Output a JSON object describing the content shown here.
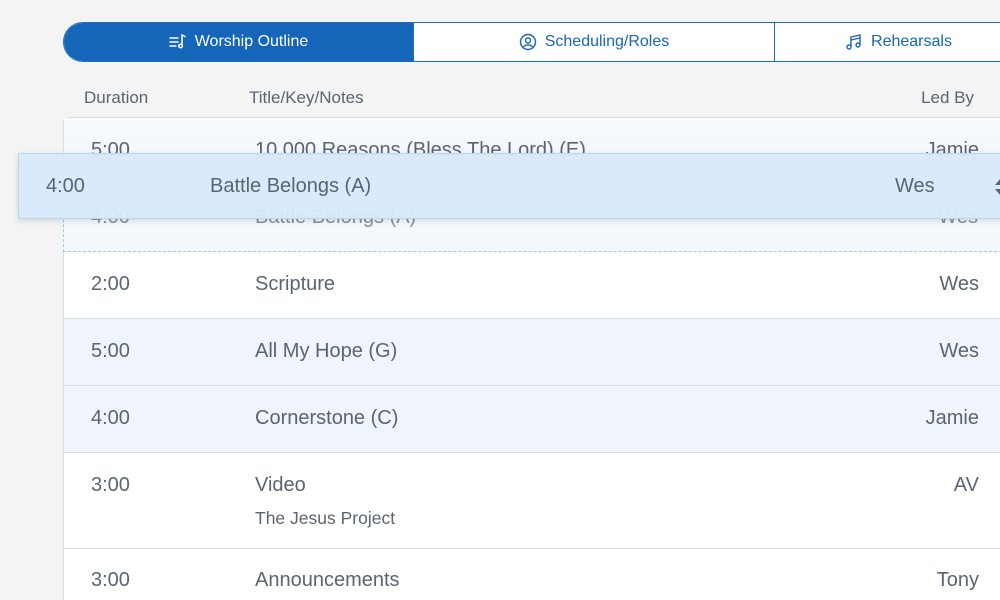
{
  "tabs": [
    {
      "label": "Worship Outline",
      "icon": "list-music-icon",
      "active": true
    },
    {
      "label": "Scheduling/Roles",
      "icon": "user-circle-icon",
      "active": false
    },
    {
      "label": "Rehearsals",
      "icon": "music-note-icon",
      "active": false
    }
  ],
  "columns": {
    "duration": "Duration",
    "title": "Title/Key/Notes",
    "led_by": "Led By"
  },
  "rows": [
    {
      "duration": "5:00",
      "title": "10,000 Reasons (Bless The Lord) (E)",
      "led_by": "Jamie"
    },
    {
      "duration": "4:00",
      "title": "Battle Belongs (A)",
      "led_by": "Wes",
      "placeholder": true
    },
    {
      "duration": "2:00",
      "title": "Scripture",
      "led_by": "Wes"
    },
    {
      "duration": "5:00",
      "title": "All My Hope (G)",
      "led_by": "Wes"
    },
    {
      "duration": "4:00",
      "title": "Cornerstone (C)",
      "led_by": "Jamie"
    },
    {
      "duration": "3:00",
      "title": "Video",
      "note": "The Jesus Project",
      "led_by": "AV"
    },
    {
      "duration": "3:00",
      "title": "Announcements",
      "led_by": "Tony"
    }
  ],
  "dragging": {
    "duration": "4:00",
    "title": "Battle Belongs (A)",
    "led_by": "Wes"
  },
  "colors": {
    "accent": "#1565b8",
    "row_tint": "#eff5fa",
    "drag_bg": "#d6e9fb"
  }
}
